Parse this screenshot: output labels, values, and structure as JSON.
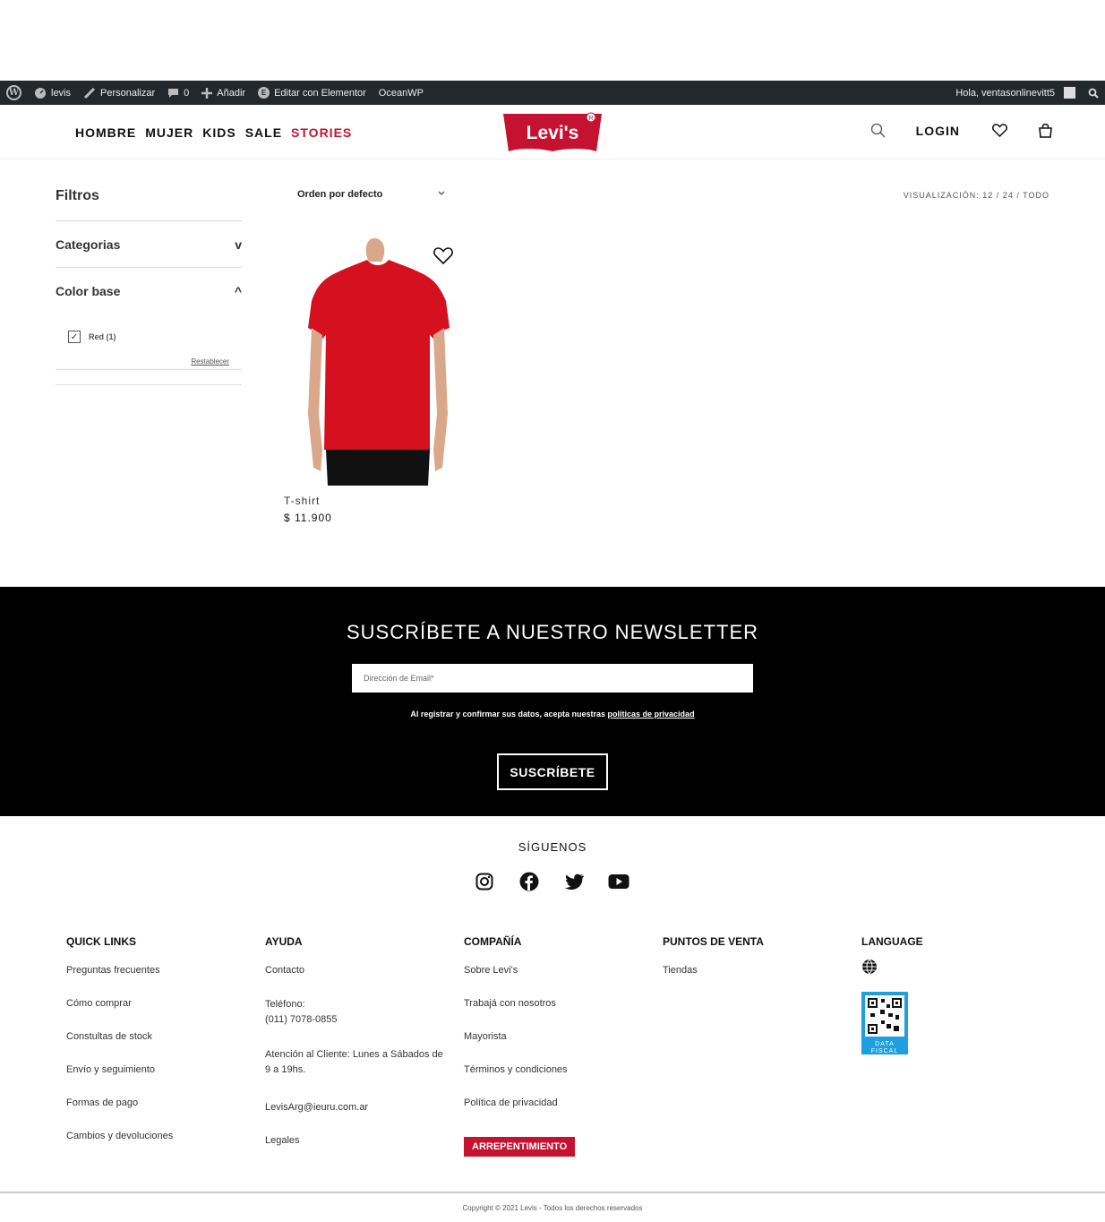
{
  "admin_bar": {
    "site": "levis",
    "customize": "Personalizar",
    "comments": "0",
    "add": "Añadir",
    "elementor": "Editar con Elementor",
    "theme": "OceanWP",
    "greeting": "Hola, ventasonlinevitt5"
  },
  "header": {
    "nav": [
      "HOMBRE",
      "MUJER",
      "KIDS",
      "SALE",
      "STORIES"
    ],
    "logo": "Levi's",
    "login": "LOGIN",
    "accent": "#c41230"
  },
  "sidebar": {
    "title": "Filtros",
    "categories": {
      "label": "Categorias",
      "toggle": "v"
    },
    "color": {
      "label": "Color base",
      "toggle": "^",
      "option": "Red (1)",
      "reset": "Restablecer"
    }
  },
  "toolbar": {
    "sort": "Orden por defecto",
    "view_label": "VISUALIZACIÓN:",
    "view_options": "12 / 24 / TODO"
  },
  "product": {
    "name": "T-shirt",
    "price": "$ 11.900"
  },
  "newsletter": {
    "title": "SUSCRÍBETE A NUESTRO NEWSLETTER",
    "placeholder": "Dirección de Email*",
    "note": "Al registrar y confirmar sus datos, acepta nuestras",
    "note_link": "politicas de privacidad",
    "button": "SUSCRÍBETE"
  },
  "follow": {
    "title": "SÍGUENOS",
    "icons": [
      "instagram-icon",
      "facebook-icon",
      "twitter-icon",
      "youtube-icon"
    ]
  },
  "footer": {
    "quick_links": {
      "title": "QUICK LINKS",
      "items": [
        "Preguntas frecuentes",
        "Cómo comprar",
        "Constultas de stock",
        "Envío y seguimiento",
        "Formas de pago",
        "Cambios y devoluciones"
      ]
    },
    "ayuda": {
      "title": "AYUDA",
      "contact": "Contacto",
      "phone_label": "Teléfono:",
      "phone": "(011) 7078-0855",
      "hours": "Atención al Cliente: Lunes a Sábados de 9 a 19hs.",
      "email": "LevisArg@ieuru.com.ar",
      "legal": "Legales"
    },
    "compania": {
      "title": "COMPAÑÍA",
      "items": [
        "Sobre Levi's",
        "Trabajá con nosotros",
        "Mayorista",
        "Términos y condiciones",
        "Política de privacidad"
      ],
      "button": "ARREPENTIMIENTO"
    },
    "puntos": {
      "title": "PUNTOS DE VENTA",
      "items": [
        "Tiendas"
      ]
    },
    "language": {
      "title": "LANGUAGE",
      "qr_label": "DATA FISCAL"
    },
    "copyright": "Copyright © 2021 Levis - Todos los derechos reservados"
  }
}
